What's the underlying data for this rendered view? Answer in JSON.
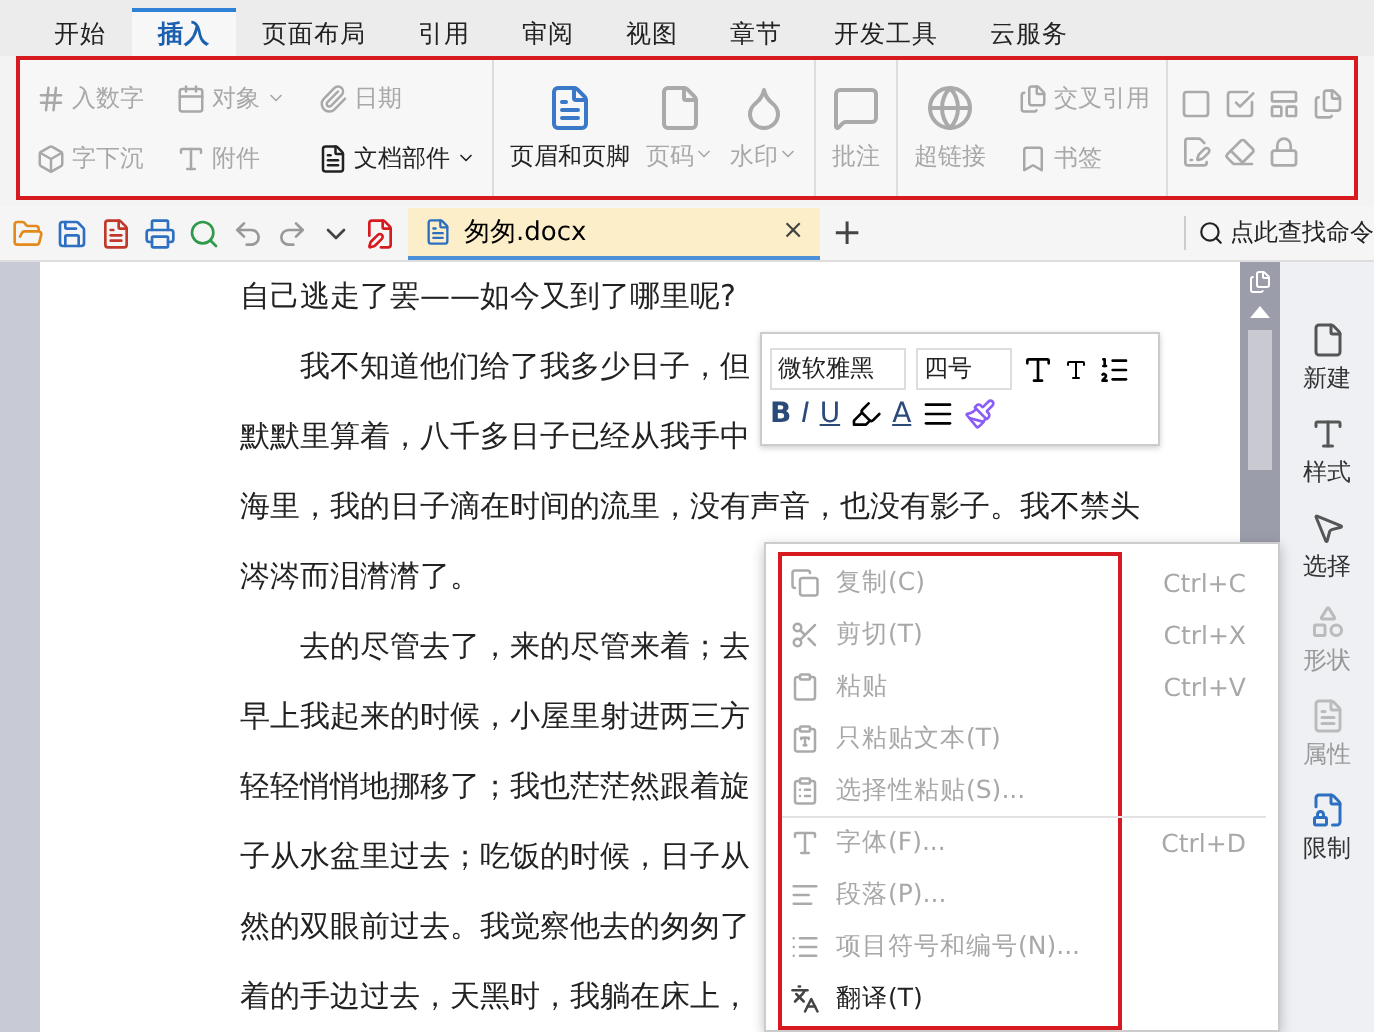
{
  "menu_tabs": [
    {
      "label": "开始",
      "selected": false
    },
    {
      "label": "插入",
      "selected": true
    },
    {
      "label": "页面布局",
      "selected": false
    },
    {
      "label": "引用",
      "selected": false
    },
    {
      "label": "审阅",
      "selected": false
    },
    {
      "label": "视图",
      "selected": false
    },
    {
      "label": "章节",
      "selected": false
    },
    {
      "label": "开发工具",
      "selected": false
    },
    {
      "label": "云服务",
      "selected": false
    }
  ],
  "ribbon": {
    "annotation_frame": true,
    "groups": [
      {
        "kind": "small",
        "items": [
          {
            "label": "入数字",
            "disabled": true,
            "dropdown": false
          },
          {
            "label": "字下沉",
            "disabled": true,
            "dropdown": false
          }
        ]
      },
      {
        "kind": "small",
        "items": [
          {
            "label": "对象",
            "disabled": true,
            "dropdown": true
          },
          {
            "label": "附件",
            "disabled": true,
            "dropdown": false
          }
        ]
      },
      {
        "kind": "small",
        "items": [
          {
            "label": "日期",
            "disabled": true,
            "dropdown": false
          },
          {
            "label": "文档部件",
            "disabled": false,
            "dropdown": true
          }
        ]
      },
      {
        "kind": "large",
        "items": [
          {
            "label": "页眉和页脚",
            "disabled": false,
            "dropdown": false
          },
          {
            "label": "页码",
            "disabled": true,
            "dropdown": true
          },
          {
            "label": "水印",
            "disabled": true,
            "dropdown": true
          }
        ]
      },
      {
        "kind": "large",
        "items": [
          {
            "label": "批注",
            "disabled": true,
            "dropdown": false
          }
        ]
      },
      {
        "kind": "large",
        "items": [
          {
            "label": "超链接",
            "disabled": true,
            "dropdown": false
          }
        ]
      },
      {
        "kind": "small",
        "items": [
          {
            "label": "交叉引用",
            "disabled": true,
            "dropdown": false
          },
          {
            "label": "书签",
            "disabled": true,
            "dropdown": false
          }
        ]
      },
      {
        "kind": "icons"
      }
    ]
  },
  "quick_toolbar": {
    "document_tab": {
      "title": "匆匆.docx",
      "close": "×"
    },
    "new_tab": "+",
    "search": {
      "placeholder": "点此查找命令"
    }
  },
  "document": {
    "lines": [
      "自己逃走了罢——如今又到了哪里呢?",
      "　　我不知道他们给了我多少日子，但",
      "默默里算着，八千多日子已经从我手中",
      "海里，我的日子滴在时间的流里，没有声音，也没有影子。我不禁头",
      "涔涔而泪潸潸了。",
      "　　去的尽管去了，来的尽管来着；去",
      "早上我起来的时候，小屋里射进两三方",
      "轻轻悄悄地挪移了；我也茫茫然跟着旋",
      "子从水盆里过去；吃饭的时候，日子从",
      "然的双眼前过去。我觉察他去的匆匆了",
      "着的手边过去，天黑时，我躺在床上，"
    ]
  },
  "mini_toolbar": {
    "font": "微软雅黑",
    "size": "四号",
    "bold": "B",
    "italic": "I",
    "underline": "U",
    "font_color": "A"
  },
  "context_menu": {
    "annotation_frame": true,
    "items": [
      {
        "label": "复制(C)",
        "shortcut": "Ctrl+C",
        "disabled": true,
        "separator_before": false
      },
      {
        "label": "剪切(T)",
        "shortcut": "Ctrl+X",
        "disabled": true,
        "separator_before": false
      },
      {
        "label": "粘贴",
        "shortcut": "Ctrl+V",
        "disabled": true,
        "separator_before": false
      },
      {
        "label": "只粘贴文本(T)",
        "disabled": true,
        "separator_before": false
      },
      {
        "label": "选择性粘贴(S)...",
        "disabled": true,
        "separator_before": false
      },
      {
        "label": "字体(F)...",
        "shortcut": "Ctrl+D",
        "disabled": true,
        "separator_before": true
      },
      {
        "label": "段落(P)...",
        "disabled": true,
        "separator_before": false
      },
      {
        "label": "项目符号和编号(N)...",
        "disabled": true,
        "separator_before": false
      },
      {
        "label": "翻译(T)",
        "disabled": false,
        "separator_before": false
      }
    ]
  },
  "sidebar": {
    "items": [
      {
        "label": "新建",
        "disabled": false,
        "highlight": false
      },
      {
        "label": "样式",
        "disabled": false,
        "highlight": false
      },
      {
        "label": "选择",
        "disabled": false,
        "highlight": false
      },
      {
        "label": "形状",
        "disabled": true,
        "highlight": false
      },
      {
        "label": "属性",
        "disabled": true,
        "highlight": false
      },
      {
        "label": "限制",
        "disabled": false,
        "highlight": true
      }
    ]
  }
}
